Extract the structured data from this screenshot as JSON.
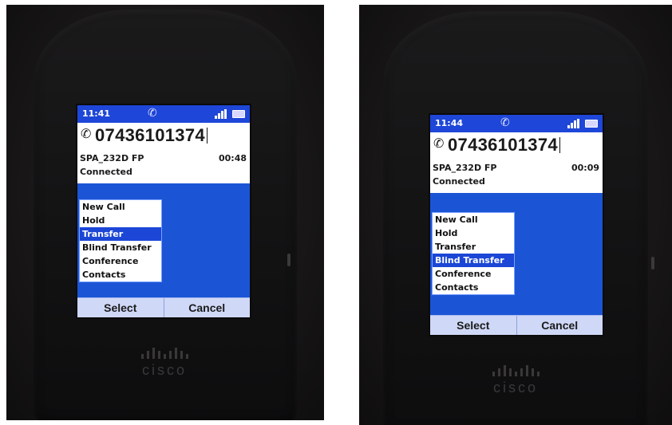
{
  "phones": [
    {
      "status": {
        "time": "11:41"
      },
      "dialed_number": "07436101374",
      "line_name": "SPA_232D FP",
      "duration": "00:48",
      "call_state": "Connected",
      "menu_items": [
        "New Call",
        "Hold",
        "Transfer",
        "Blind Transfer",
        "Conference",
        "Contacts"
      ],
      "selected_item": "Transfer",
      "softkeys": {
        "left": "Select",
        "right": "Cancel"
      },
      "brand": "cisco"
    },
    {
      "status": {
        "time": "11:44"
      },
      "dialed_number": "07436101374",
      "line_name": "SPA_232D FP",
      "duration": "00:09",
      "call_state": "Connected",
      "menu_items": [
        "New Call",
        "Hold",
        "Transfer",
        "Blind Transfer",
        "Conference",
        "Contacts"
      ],
      "selected_item": "Blind Transfer",
      "softkeys": {
        "left": "Select",
        "right": "Cancel"
      },
      "brand": "cisco"
    }
  ],
  "icons": {
    "call": "active-call-icon",
    "signal": "signal-strength-icon",
    "battery": "battery-icon",
    "handset": "handset-icon"
  },
  "colors": {
    "screen_blue": "#1b55d6",
    "selected_highlight": "#1b46d6",
    "softkey_bar": "#cfd8f6",
    "phone_body": "#121213"
  }
}
